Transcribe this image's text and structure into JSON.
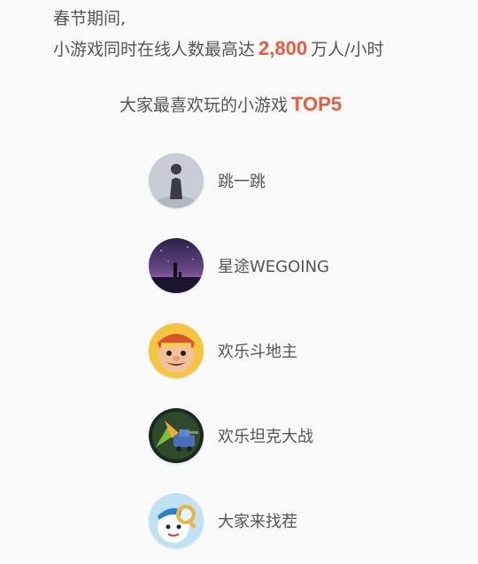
{
  "intro": {
    "line1": "春节期间,",
    "line2_prefix": "小游戏同时在线人数最高达",
    "line2_number": "2,800",
    "line2_suffix": "万人/小时"
  },
  "section": {
    "title": "大家最喜欢玩的小游戏",
    "badge": "TOP5"
  },
  "games": [
    {
      "name": "跳一跳",
      "icon": "jump-jump-icon"
    },
    {
      "name": "星途WEGOING",
      "icon": "wegoing-icon"
    },
    {
      "name": "欢乐斗地主",
      "icon": "doudizhu-icon"
    },
    {
      "name": "欢乐坦克大战",
      "icon": "tank-battle-icon"
    },
    {
      "name": "大家来找茬",
      "icon": "spot-difference-icon"
    }
  ],
  "colors": {
    "accent": "#f05a3a",
    "text": "#555555",
    "background": "#fafafa"
  }
}
